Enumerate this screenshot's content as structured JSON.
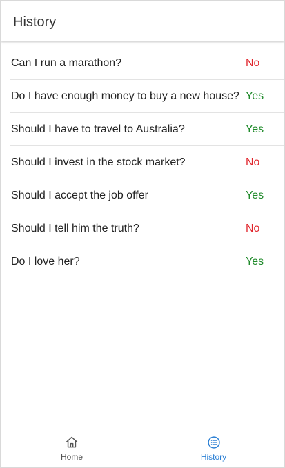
{
  "header": {
    "title": "History"
  },
  "history": {
    "items": [
      {
        "question": "Can I run a marathon?",
        "answer": "No"
      },
      {
        "question": "Do I have enough money to buy a new house?",
        "answer": "Yes"
      },
      {
        "question": "Should I have to travel to Australia?",
        "answer": "Yes"
      },
      {
        "question": "Should I invest in the stock market?",
        "answer": "No"
      },
      {
        "question": "Should I accept the job offer",
        "answer": "Yes"
      },
      {
        "question": "Should I tell him the truth?",
        "answer": "No"
      },
      {
        "question": "Do I love her?",
        "answer": "Yes"
      }
    ]
  },
  "bottom_nav": {
    "home_label": "Home",
    "history_label": "History",
    "home_icon": "home-icon",
    "history_icon": "list-icon",
    "active": "History"
  },
  "colors": {
    "yes": "#1f8a2a",
    "no": "#e0242b",
    "active_tab": "#2a7fd4",
    "inactive_tab": "#555555"
  }
}
